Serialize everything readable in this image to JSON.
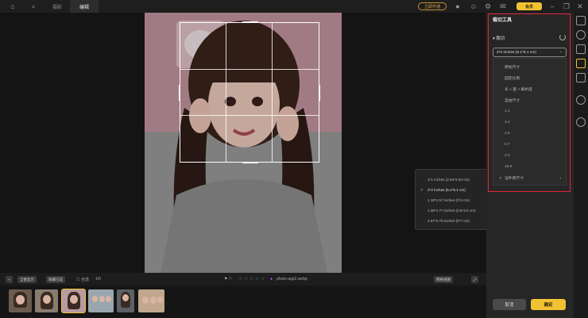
{
  "topbar": {
    "tabs": [
      "摄影",
      "编辑"
    ],
    "active_tab": "编辑",
    "vip_label": "立即开通",
    "buy_label": "会员"
  },
  "canvas": {
    "photo_filename": "photo-app2.webp",
    "popup_options": [
      "1*1 inches (2.54*2.54 cm)",
      "2*2 inches (5.1*5.1 cm)",
      "1.18*1.57 inches (3*4 cm)",
      "1.38*1.77 inches (3.5*4.5 cm)",
      "1.97*2.76 inches (5*7 cm)"
    ],
    "popup_selected": "2*2 inches (5.1*5.1 cm)"
  },
  "panel": {
    "title": "裁切工具",
    "section_label": "裁切",
    "select_value": "2*2 inches (5.1*5.1 cm)",
    "dropdown_items": [
      "原始尺寸",
      "固定比例",
      "长 × 宽 × 解析度",
      "自由尺寸",
      "1:1",
      "3:4",
      "4:5",
      "5:7",
      "2:3",
      "16:9",
      "证件照尺寸"
    ],
    "dropdown_checked": "证件照尺寸",
    "cancel_label": "取消",
    "confirm_label": "确定"
  },
  "bottombar": {
    "btn1": "全部显示",
    "btn2": "隐藏已选",
    "select_all": "全选",
    "counter": "1/6",
    "view_label": "网格视图"
  },
  "colors": {
    "accent": "#f1c232",
    "highlight": "#e0263a",
    "panel_bg": "#262626"
  }
}
